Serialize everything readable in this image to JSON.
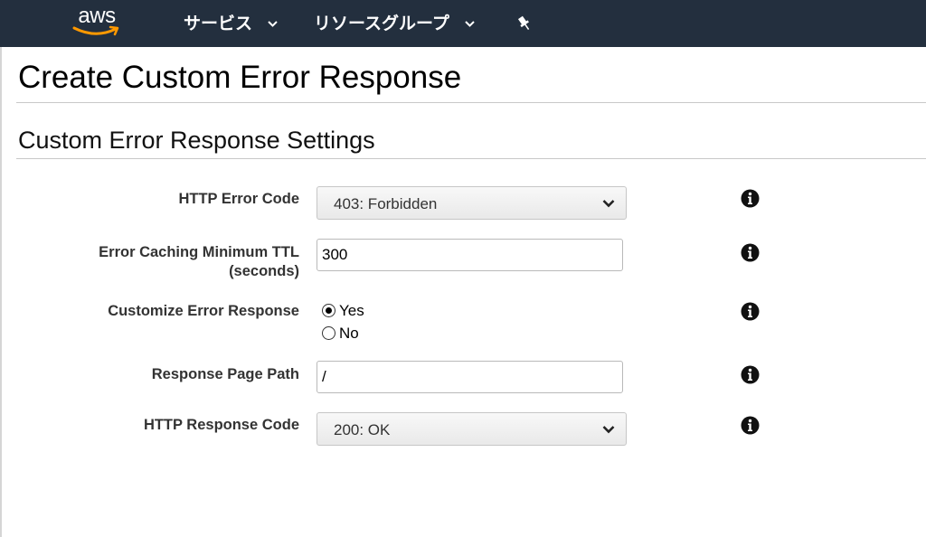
{
  "nav": {
    "logo_text": "aws",
    "services_label": "サービス",
    "resource_groups_label": "リソースグループ",
    "pin_icon": "pushpin-icon",
    "chevron_icon": "chevron-down-icon"
  },
  "page": {
    "title": "Create Custom Error Response",
    "section_title": "Custom Error Response Settings"
  },
  "form": {
    "http_error_code": {
      "label": "HTTP Error Code",
      "selected": "403: Forbidden"
    },
    "error_caching_ttl": {
      "label_line1": "Error Caching Minimum TTL",
      "label_line2": "(seconds)",
      "value": "300"
    },
    "customize_error_response": {
      "label": "Customize Error Response",
      "options": [
        "Yes",
        "No"
      ],
      "selected": "Yes"
    },
    "response_page_path": {
      "label": "Response Page Path",
      "value": "/"
    },
    "http_response_code": {
      "label": "HTTP Response Code",
      "selected": "200: OK"
    }
  },
  "colors": {
    "nav_bg": "#232f3e",
    "aws_orange": "#ff9900"
  }
}
